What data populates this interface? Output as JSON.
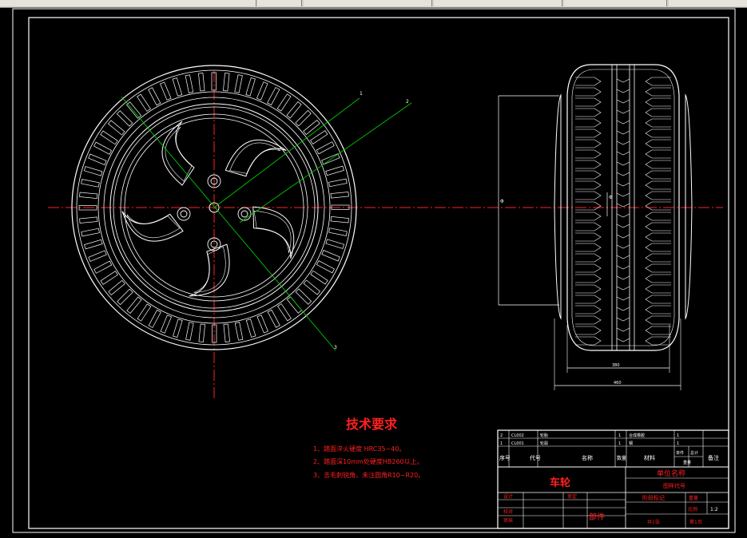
{
  "toolbar": {
    "segments": [
      "",
      "",
      "",
      "",
      "",
      ""
    ]
  },
  "tech": {
    "title": "技术要求",
    "items": [
      "1、踏面淬火硬度 HRC35~40。",
      "2、踏面深10mm处硬度HB260以上。",
      "3、去毛刺锐角，未注圆角R10~R20。"
    ]
  },
  "dims": {
    "side_width": "380",
    "overall_width": "460",
    "height_label": "Φ",
    "hub_label": "Φ",
    "leader_1": "1",
    "leader_2": "2",
    "leader_3": "3"
  },
  "title_block": {
    "part_name": "车轮",
    "company": "单位名称",
    "drawing_no": "图样代号",
    "part_kind": "部件",
    "rows": [
      {
        "no": "2",
        "code": "CL002",
        "name": "轮胎",
        "qty": "1",
        "material": "合成橡胶",
        "count": "1"
      },
      {
        "no": "1",
        "code": "CL001",
        "name": "轮毂",
        "qty": "1",
        "material": "钢",
        "count": "1"
      }
    ],
    "headers": {
      "no": "序号",
      "code": "代号",
      "name": "名称",
      "qty": "数量",
      "material": "材料",
      "single": "单件",
      "total": "总计",
      "weight": "重量",
      "remark": "备注"
    },
    "design": "设计",
    "check": "校对",
    "review": "审核",
    "approve": "审定",
    "stage": "阶段标记",
    "weight2": "重量",
    "ratio": "比例",
    "ratio_val": "1:2",
    "sheets": "共1张",
    "sheet": "第1页"
  }
}
